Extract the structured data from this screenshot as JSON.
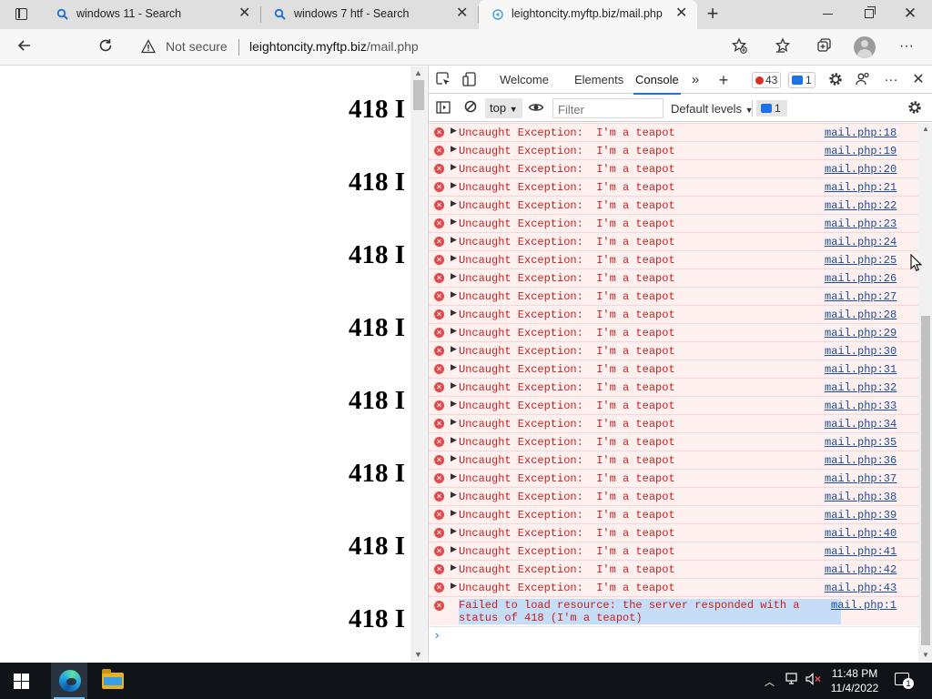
{
  "browser": {
    "tabs": [
      {
        "label": "windows 11 - Search",
        "favicon": "search-icon",
        "active": false
      },
      {
        "label": "windows 7 htf - Search",
        "favicon": "search-icon",
        "active": false
      },
      {
        "label": "leightoncity.myftp.biz/mail.php",
        "favicon": "globe-icon",
        "active": true
      }
    ],
    "security_label": "Not secure",
    "url_host": "leightoncity.myftp.biz",
    "url_path": "/mail.php"
  },
  "page": {
    "lines": [
      "418 I",
      "418 I",
      "418 I",
      "418 I",
      "418 I",
      "418 I",
      "418 I",
      "418 I"
    ]
  },
  "devtools": {
    "tabs": [
      "Welcome",
      "Elements",
      "Console"
    ],
    "active_tab": "Console",
    "error_count": "43",
    "message_count": "1",
    "context": "top",
    "filter_placeholder": "Filter",
    "levels": "Default levels",
    "messages_badge": "1",
    "log": [
      {
        "msg": "Uncaught Exception:  I'm a teapot",
        "src": "mail.php:18"
      },
      {
        "msg": "Uncaught Exception:  I'm a teapot",
        "src": "mail.php:19"
      },
      {
        "msg": "Uncaught Exception:  I'm a teapot",
        "src": "mail.php:20"
      },
      {
        "msg": "Uncaught Exception:  I'm a teapot",
        "src": "mail.php:21"
      },
      {
        "msg": "Uncaught Exception:  I'm a teapot",
        "src": "mail.php:22"
      },
      {
        "msg": "Uncaught Exception:  I'm a teapot",
        "src": "mail.php:23"
      },
      {
        "msg": "Uncaught Exception:  I'm a teapot",
        "src": "mail.php:24"
      },
      {
        "msg": "Uncaught Exception:  I'm a teapot",
        "src": "mail.php:25"
      },
      {
        "msg": "Uncaught Exception:  I'm a teapot",
        "src": "mail.php:26"
      },
      {
        "msg": "Uncaught Exception:  I'm a teapot",
        "src": "mail.php:27"
      },
      {
        "msg": "Uncaught Exception:  I'm a teapot",
        "src": "mail.php:28"
      },
      {
        "msg": "Uncaught Exception:  I'm a teapot",
        "src": "mail.php:29"
      },
      {
        "msg": "Uncaught Exception:  I'm a teapot",
        "src": "mail.php:30"
      },
      {
        "msg": "Uncaught Exception:  I'm a teapot",
        "src": "mail.php:31"
      },
      {
        "msg": "Uncaught Exception:  I'm a teapot",
        "src": "mail.php:32"
      },
      {
        "msg": "Uncaught Exception:  I'm a teapot",
        "src": "mail.php:33"
      },
      {
        "msg": "Uncaught Exception:  I'm a teapot",
        "src": "mail.php:34"
      },
      {
        "msg": "Uncaught Exception:  I'm a teapot",
        "src": "mail.php:35"
      },
      {
        "msg": "Uncaught Exception:  I'm a teapot",
        "src": "mail.php:36"
      },
      {
        "msg": "Uncaught Exception:  I'm a teapot",
        "src": "mail.php:37"
      },
      {
        "msg": "Uncaught Exception:  I'm a teapot",
        "src": "mail.php:38"
      },
      {
        "msg": "Uncaught Exception:  I'm a teapot",
        "src": "mail.php:39"
      },
      {
        "msg": "Uncaught Exception:  I'm a teapot",
        "src": "mail.php:40"
      },
      {
        "msg": "Uncaught Exception:  I'm a teapot",
        "src": "mail.php:41"
      },
      {
        "msg": "Uncaught Exception:  I'm a teapot",
        "src": "mail.php:42"
      },
      {
        "msg": "Uncaught Exception:  I'm a teapot",
        "src": "mail.php:43"
      }
    ],
    "failed": {
      "msg": "Failed to load resource: the server responded with a status of 418 (I'm a teapot)",
      "src": "mail.php:1"
    },
    "prompt": "›"
  },
  "taskbar": {
    "time": "11:48 PM",
    "date": "11/4/2022",
    "notifications": "1"
  },
  "colors": {
    "error_text": "#c5221f",
    "error_bg": "#fff0f0",
    "link": "#1a4fa0",
    "accent": "#1a73e8",
    "taskbar": "#101419"
  }
}
